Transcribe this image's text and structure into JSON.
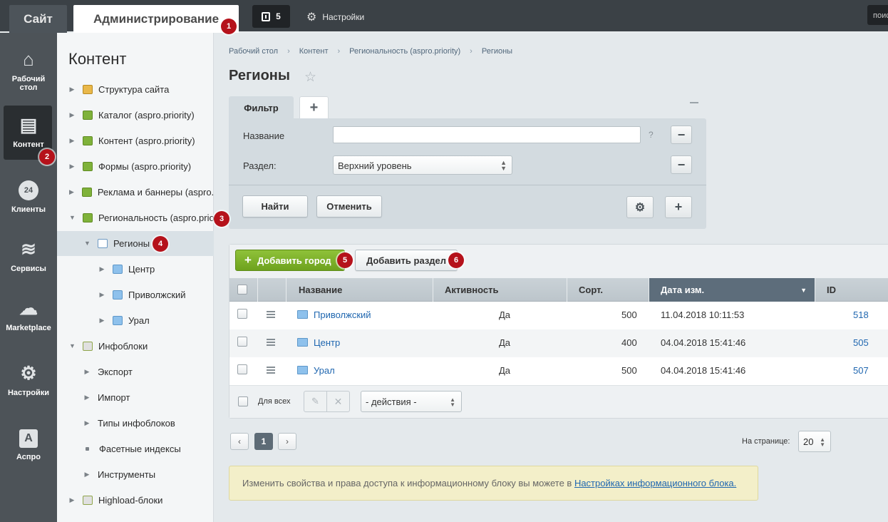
{
  "topbar": {
    "site_tab": "Сайт",
    "admin_tab": "Администрирование",
    "notifications_count": "5",
    "settings_label": "Настройки",
    "search_stub": "поис"
  },
  "iconbar": {
    "items": [
      {
        "label": "Рабочий стол",
        "icon": "home-icon"
      },
      {
        "label": "Контент",
        "icon": "document-icon"
      },
      {
        "label": "Клиенты",
        "icon": "clients-24-icon"
      },
      {
        "label": "Сервисы",
        "icon": "layers-icon"
      },
      {
        "label": "Marketplace",
        "icon": "cloud-download-icon"
      },
      {
        "label": "Настройки",
        "icon": "gear-icon"
      },
      {
        "label": "Аспро",
        "icon": "aspro-a-icon"
      }
    ]
  },
  "leftpanel": {
    "title": "Контент",
    "tree": [
      "Структура сайта",
      "Каталог (aspro.priority)",
      "Контент (aspro.priority)",
      "Формы (aspro.priority)",
      "Реклама и баннеры (aspro.priority)",
      "Региональность (aspro.priority)",
      "Регионы",
      "Центр",
      "Приволжский",
      "Урал",
      "Инфоблоки",
      "Экспорт",
      "Импорт",
      "Типы инфоблоков",
      "Фасетные индексы",
      "Инструменты",
      "Highload-блоки"
    ]
  },
  "breadcrumb": [
    "Рабочий стол",
    "Контент",
    "Региональность (aspro.priority)",
    "Регионы"
  ],
  "breadcrumb_sep": "›",
  "page_title": "Регионы",
  "filter": {
    "tab": "Фильтр",
    "add_tab": "+",
    "name_label": "Название",
    "name_value": "",
    "help": "?",
    "section_label": "Раздел:",
    "section_value": "Верхний уровень",
    "find": "Найти",
    "cancel": "Отменить",
    "remove_symbol": "−",
    "add_symbol": "+"
  },
  "list": {
    "add_city": "Добавить город",
    "add_section": "Добавить раздел",
    "columns": [
      "Название",
      "Активность",
      "Сорт.",
      "Дата изм.",
      "ID"
    ],
    "rows": [
      {
        "name": "Приволжский",
        "active": "Да",
        "sort": "500",
        "date": "11.04.2018 10:11:53",
        "id": "518"
      },
      {
        "name": "Центр",
        "active": "Да",
        "sort": "400",
        "date": "04.04.2018 15:41:46",
        "id": "505"
      },
      {
        "name": "Урал",
        "active": "Да",
        "sort": "500",
        "date": "04.04.2018 15:41:46",
        "id": "507"
      }
    ],
    "for_all": "Для всех",
    "actions": "- действия -"
  },
  "pagination": {
    "prev": "‹",
    "current": "1",
    "next": "›",
    "per_page_label": "На странице:",
    "per_page": "20"
  },
  "notice": {
    "text": "Изменить свойства и права доступа к информационному блоку вы можете в ",
    "link": "Настройках информационного блока."
  },
  "badges": [
    "1",
    "2",
    "3",
    "4",
    "5",
    "6"
  ],
  "colors": {
    "accent_green": "#7ab02c",
    "badge_red": "#b5121b",
    "link_blue": "#2067b0",
    "sorted_header": "#5d6d7b"
  }
}
